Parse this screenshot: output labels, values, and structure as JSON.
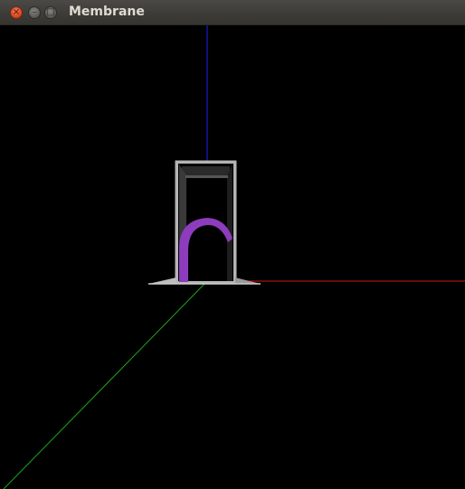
{
  "window": {
    "title": "Membrane"
  },
  "controls": {
    "close_icon": "close-icon",
    "minimize_icon": "minimize-icon",
    "maximize_icon": "maximize-icon"
  },
  "scene": {
    "background": "#000000",
    "axis_colors": {
      "x": "#cc0000",
      "y": "#0000cc",
      "z": "#00aa00"
    },
    "frame_color": "#b4b4b4",
    "membrane_color": "#8e3fbf"
  }
}
